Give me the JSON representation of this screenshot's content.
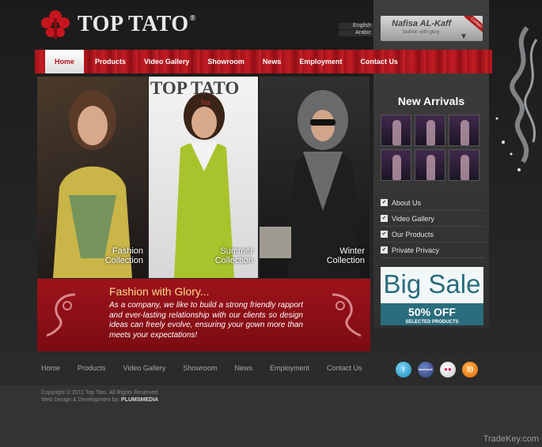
{
  "brand": {
    "name": "TOP TATO",
    "registered": "®"
  },
  "languages": [
    "English",
    "Arabic"
  ],
  "account": {
    "name": "Nafisa AL-Kaff",
    "tagline": "fashion with glory",
    "ribbon": "Contact"
  },
  "nav": {
    "items": [
      "Home",
      "Products",
      "Video Gallery",
      "Showroom",
      "News",
      "Employment",
      "Contact Us"
    ],
    "active": "Home"
  },
  "photos": [
    {
      "caption_top": "Fashion",
      "caption_bottom": "Collection"
    },
    {
      "brand": "TOP TATO",
      "brand_sub": "Na",
      "caption_top": "Summer",
      "caption_bottom": "Collection"
    },
    {
      "caption_top": "Winter",
      "caption_bottom": "Collection"
    }
  ],
  "banner": {
    "title": "Fashion with Glory...",
    "text": "As a company, we like to build a strong friendly rapport and ever-lasting relationship with our clients so design ideas can freely evolve, ensuring your gown more than meets your expectations!"
  },
  "sidebar": {
    "new_arrivals_title": "New Arrivals",
    "thumb_count": 6,
    "links": [
      "About Us",
      "Video Gallery",
      "Our Products",
      "Private Privacy"
    ],
    "sale": {
      "headline": "Big Sale",
      "offer": "50% OFF",
      "sub": "SELECTED PRODUCTS"
    }
  },
  "footer": {
    "nav": [
      "Home",
      "Products",
      "Video Gallery",
      "Showroom",
      "News",
      "Employment",
      "Contact Us"
    ],
    "socials": [
      "twitter-icon",
      "facebook-icon",
      "flickr-icon",
      "rss-icon"
    ],
    "social_labels": {
      "facebook": "facebook"
    },
    "copyright": "Copyright © 2011 Top Tato. All Rights Reserved.",
    "credit_prefix": "Web Design & Development by:",
    "credit_name": "PLUMSMEDIA"
  },
  "watermark": "TradeKey.com",
  "colors": {
    "nav_red": "#b8161f",
    "banner_red": "#8b0f16",
    "sale_teal": "#2a6d7c",
    "title_gold": "#ffdb8a"
  }
}
